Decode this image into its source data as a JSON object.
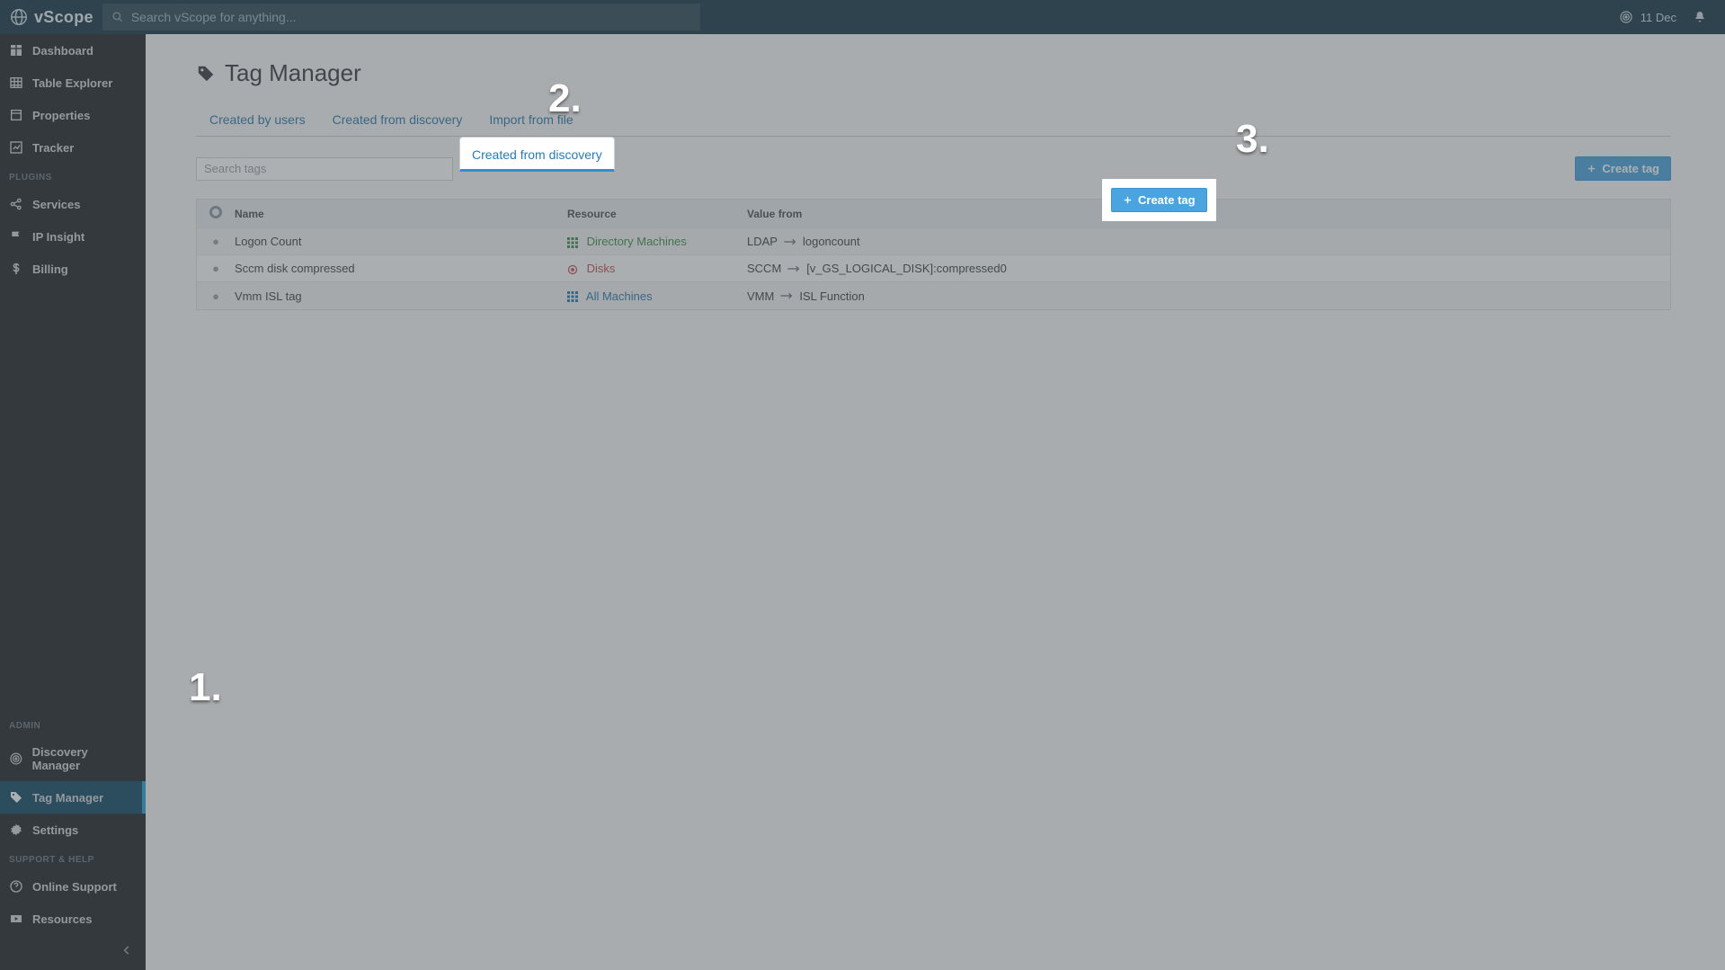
{
  "app": {
    "name": "vScope"
  },
  "topbar": {
    "search_placeholder": "Search vScope for anything...",
    "date": "11 Dec"
  },
  "sidebar": {
    "nav": [
      {
        "key": "dashboard",
        "label": "Dashboard"
      },
      {
        "key": "table-explorer",
        "label": "Table Explorer"
      },
      {
        "key": "properties",
        "label": "Properties"
      },
      {
        "key": "tracker",
        "label": "Tracker"
      }
    ],
    "plugins_header": "PLUGINS",
    "plugins": [
      {
        "key": "services",
        "label": "Services"
      },
      {
        "key": "ip-insight",
        "label": "IP Insight"
      },
      {
        "key": "billing",
        "label": "Billing"
      }
    ],
    "admin_header": "ADMIN",
    "admin": [
      {
        "key": "discovery-manager",
        "label": "Discovery Manager"
      },
      {
        "key": "tag-manager",
        "label": "Tag Manager",
        "active": true
      },
      {
        "key": "settings",
        "label": "Settings"
      }
    ],
    "support_header": "SUPPORT & HELP",
    "support": [
      {
        "key": "online-support",
        "label": "Online Support"
      },
      {
        "key": "resources",
        "label": "Resources"
      }
    ]
  },
  "page": {
    "title": "Tag Manager",
    "tabs": [
      {
        "key": "by-users",
        "label": "Created by users"
      },
      {
        "key": "from-discovery",
        "label": "Created from discovery",
        "active": true
      },
      {
        "key": "import-file",
        "label": "Import from file"
      }
    ],
    "search_tags_placeholder": "Search tags",
    "create_button": "Create tag",
    "columns": {
      "name": "Name",
      "resource": "Resource",
      "value": "Value from"
    },
    "rows": [
      {
        "name": "Logon Count",
        "resource": "Directory Machines",
        "resource_color": "green",
        "value_src": "LDAP",
        "value_dst": "logoncount"
      },
      {
        "name": "Sccm disk compressed",
        "resource": "Disks",
        "resource_color": "red",
        "value_src": "SCCM",
        "value_dst": "[v_GS_LOGICAL_DISK]:compressed0"
      },
      {
        "name": "Vmm ISL tag",
        "resource": "All Machines",
        "resource_color": "blue",
        "value_src": "VMM",
        "value_dst": "ISL Function"
      }
    ]
  },
  "annotations": {
    "n1": "1.",
    "n2": "2.",
    "n3": "3."
  }
}
